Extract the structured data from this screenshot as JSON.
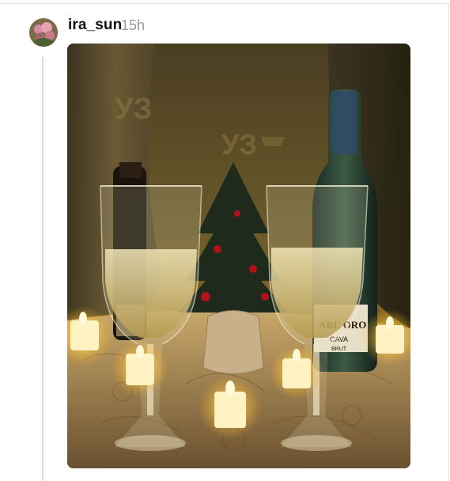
{
  "post": {
    "username": "ira_sun",
    "timestamp": "15h",
    "avatar_icon": "user-avatar-icon",
    "photo": {
      "subject": "champagne-glasses-candles-photo",
      "visible_text": [
        "УЗ",
        "УЗ",
        "CAVA",
        "BRUT",
        "ARE ORO"
      ]
    }
  },
  "colors": {
    "username": "#111111",
    "timestamp": "#9a9a9a",
    "thread_line": "#dcdcdc",
    "candle_glow": "#ffd35a",
    "background_curtain": "#6e5c2f"
  }
}
